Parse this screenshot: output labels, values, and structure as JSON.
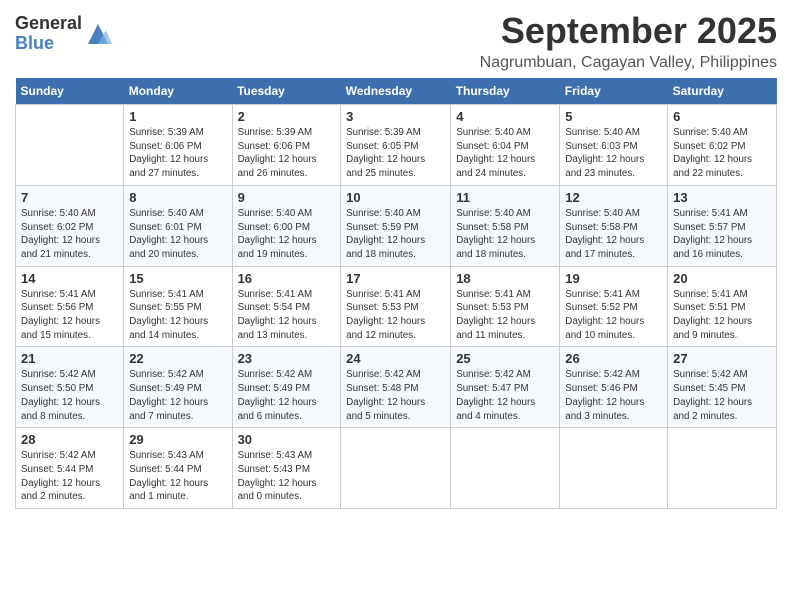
{
  "logo": {
    "general": "General",
    "blue": "Blue"
  },
  "title": "September 2025",
  "location": "Nagrumbuan, Cagayan Valley, Philippines",
  "days_of_week": [
    "Sunday",
    "Monday",
    "Tuesday",
    "Wednesday",
    "Thursday",
    "Friday",
    "Saturday"
  ],
  "weeks": [
    [
      {
        "day": "",
        "info": ""
      },
      {
        "day": "1",
        "info": "Sunrise: 5:39 AM\nSunset: 6:06 PM\nDaylight: 12 hours\nand 27 minutes."
      },
      {
        "day": "2",
        "info": "Sunrise: 5:39 AM\nSunset: 6:06 PM\nDaylight: 12 hours\nand 26 minutes."
      },
      {
        "day": "3",
        "info": "Sunrise: 5:39 AM\nSunset: 6:05 PM\nDaylight: 12 hours\nand 25 minutes."
      },
      {
        "day": "4",
        "info": "Sunrise: 5:40 AM\nSunset: 6:04 PM\nDaylight: 12 hours\nand 24 minutes."
      },
      {
        "day": "5",
        "info": "Sunrise: 5:40 AM\nSunset: 6:03 PM\nDaylight: 12 hours\nand 23 minutes."
      },
      {
        "day": "6",
        "info": "Sunrise: 5:40 AM\nSunset: 6:02 PM\nDaylight: 12 hours\nand 22 minutes."
      }
    ],
    [
      {
        "day": "7",
        "info": "Sunrise: 5:40 AM\nSunset: 6:02 PM\nDaylight: 12 hours\nand 21 minutes."
      },
      {
        "day": "8",
        "info": "Sunrise: 5:40 AM\nSunset: 6:01 PM\nDaylight: 12 hours\nand 20 minutes."
      },
      {
        "day": "9",
        "info": "Sunrise: 5:40 AM\nSunset: 6:00 PM\nDaylight: 12 hours\nand 19 minutes."
      },
      {
        "day": "10",
        "info": "Sunrise: 5:40 AM\nSunset: 5:59 PM\nDaylight: 12 hours\nand 18 minutes."
      },
      {
        "day": "11",
        "info": "Sunrise: 5:40 AM\nSunset: 5:58 PM\nDaylight: 12 hours\nand 18 minutes."
      },
      {
        "day": "12",
        "info": "Sunrise: 5:40 AM\nSunset: 5:58 PM\nDaylight: 12 hours\nand 17 minutes."
      },
      {
        "day": "13",
        "info": "Sunrise: 5:41 AM\nSunset: 5:57 PM\nDaylight: 12 hours\nand 16 minutes."
      }
    ],
    [
      {
        "day": "14",
        "info": "Sunrise: 5:41 AM\nSunset: 5:56 PM\nDaylight: 12 hours\nand 15 minutes."
      },
      {
        "day": "15",
        "info": "Sunrise: 5:41 AM\nSunset: 5:55 PM\nDaylight: 12 hours\nand 14 minutes."
      },
      {
        "day": "16",
        "info": "Sunrise: 5:41 AM\nSunset: 5:54 PM\nDaylight: 12 hours\nand 13 minutes."
      },
      {
        "day": "17",
        "info": "Sunrise: 5:41 AM\nSunset: 5:53 PM\nDaylight: 12 hours\nand 12 minutes."
      },
      {
        "day": "18",
        "info": "Sunrise: 5:41 AM\nSunset: 5:53 PM\nDaylight: 12 hours\nand 11 minutes."
      },
      {
        "day": "19",
        "info": "Sunrise: 5:41 AM\nSunset: 5:52 PM\nDaylight: 12 hours\nand 10 minutes."
      },
      {
        "day": "20",
        "info": "Sunrise: 5:41 AM\nSunset: 5:51 PM\nDaylight: 12 hours\nand 9 minutes."
      }
    ],
    [
      {
        "day": "21",
        "info": "Sunrise: 5:42 AM\nSunset: 5:50 PM\nDaylight: 12 hours\nand 8 minutes."
      },
      {
        "day": "22",
        "info": "Sunrise: 5:42 AM\nSunset: 5:49 PM\nDaylight: 12 hours\nand 7 minutes."
      },
      {
        "day": "23",
        "info": "Sunrise: 5:42 AM\nSunset: 5:49 PM\nDaylight: 12 hours\nand 6 minutes."
      },
      {
        "day": "24",
        "info": "Sunrise: 5:42 AM\nSunset: 5:48 PM\nDaylight: 12 hours\nand 5 minutes."
      },
      {
        "day": "25",
        "info": "Sunrise: 5:42 AM\nSunset: 5:47 PM\nDaylight: 12 hours\nand 4 minutes."
      },
      {
        "day": "26",
        "info": "Sunrise: 5:42 AM\nSunset: 5:46 PM\nDaylight: 12 hours\nand 3 minutes."
      },
      {
        "day": "27",
        "info": "Sunrise: 5:42 AM\nSunset: 5:45 PM\nDaylight: 12 hours\nand 2 minutes."
      }
    ],
    [
      {
        "day": "28",
        "info": "Sunrise: 5:42 AM\nSunset: 5:44 PM\nDaylight: 12 hours\nand 2 minutes."
      },
      {
        "day": "29",
        "info": "Sunrise: 5:43 AM\nSunset: 5:44 PM\nDaylight: 12 hours\nand 1 minute."
      },
      {
        "day": "30",
        "info": "Sunrise: 5:43 AM\nSunset: 5:43 PM\nDaylight: 12 hours\nand 0 minutes."
      },
      {
        "day": "",
        "info": ""
      },
      {
        "day": "",
        "info": ""
      },
      {
        "day": "",
        "info": ""
      },
      {
        "day": "",
        "info": ""
      }
    ]
  ]
}
